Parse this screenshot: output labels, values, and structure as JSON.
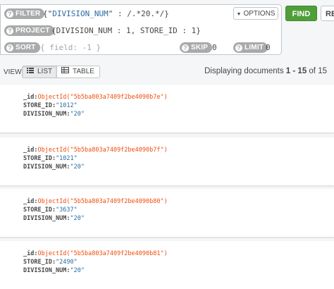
{
  "query": {
    "filter": {
      "label": "FILTER",
      "prefix": "{\"",
      "key": "DIVISION_NUM",
      "middle": "\" : /.*20.*/}"
    },
    "project": {
      "label": "PROJECT",
      "text": "{DIVISION_NUM : 1, STORE_ID : 1}"
    },
    "sort": {
      "label": "SORT",
      "placeholder": "{ field: -1 }"
    },
    "skip": {
      "label": "SKIP",
      "value": "0"
    },
    "limit": {
      "label": "LIMIT",
      "value": "0"
    },
    "options_label": "OPTIONS",
    "find_label": "FIND",
    "reset_label": "RESET"
  },
  "toolbar": {
    "view_label": "VIEW",
    "list_label": "LIST",
    "table_label": "TABLE",
    "status_prefix": "Displaying documents ",
    "range_start": "1",
    "range_sep": " - ",
    "range_end": "15",
    "of_text": " of ",
    "total": "15"
  },
  "documents": [
    {
      "id_key": "_id:",
      "id_value": "ObjectId(\"5b5ba803a7409f2be4090b7e\")",
      "store_key": "STORE_ID:",
      "store_value": "\"1012\"",
      "div_key": "DIVISION_NUM:",
      "div_value": "\"20\""
    },
    {
      "id_key": "_id:",
      "id_value": "ObjectId(\"5b5ba803a7409f2be4090b7f\")",
      "store_key": "STORE_ID:",
      "store_value": "\"1021\"",
      "div_key": "DIVISION_NUM:",
      "div_value": "\"20\""
    },
    {
      "id_key": "_id:",
      "id_value": "ObjectId(\"5b5ba803a7409f2be4090b80\")",
      "store_key": "STORE_ID:",
      "store_value": "\"3637\"",
      "div_key": "DIVISION_NUM:",
      "div_value": "\"20\""
    },
    {
      "id_key": "_id:",
      "id_value": "ObjectId(\"5b5ba803a7409f2be4090b81\")",
      "store_key": "STORE_ID:",
      "store_value": "\"2490\"",
      "div_key": "DIVISION_NUM:",
      "div_value": "\"20\""
    }
  ]
}
